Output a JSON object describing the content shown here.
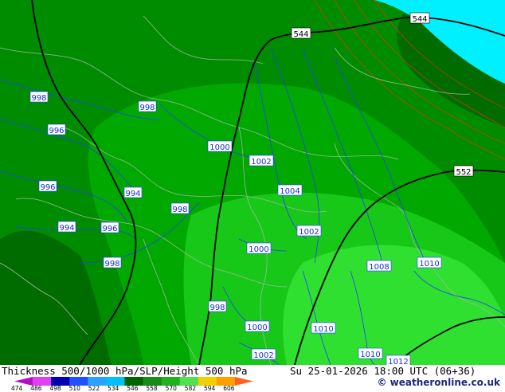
{
  "header": {
    "title": "Thickness 500/1000 hPa/SLP/Height 500 hPa",
    "valid_time": "Su 25-01-2026 18:00 UTC (06+36)",
    "credit": "© weatheronline.co.uk"
  },
  "legend": {
    "colors": [
      "#b010c0",
      "#e040f0",
      "#0000b0",
      "#2050ff",
      "#2aa0ff",
      "#00c0ff",
      "#006400",
      "#1a8a1a",
      "#20b020",
      "#50e050",
      "#f0d000",
      "#ffa000",
      "#ff6020"
    ],
    "ticks": [
      "474",
      "486",
      "498",
      "510",
      "522",
      "534",
      "546",
      "558",
      "570",
      "582",
      "594",
      "606"
    ]
  },
  "map": {
    "colors": {
      "sea": "#00f0ff",
      "dark_green": "#006c00",
      "mid_green": "#008c00",
      "green": "#00a800",
      "light_green": "#18c818",
      "bright_green": "#30e030",
      "isobar": "#2040ff",
      "height_contour": "#000000",
      "thickness_line": "#ff3000",
      "border": "#9ab89a"
    },
    "height_labels": [
      "544",
      "544",
      "552"
    ],
    "pressure_labels": [
      "998",
      "998",
      "996",
      "996",
      "994",
      "994",
      "996",
      "998",
      "998",
      "998",
      "1000",
      "1002",
      "1004",
      "1002",
      "1000",
      "1008",
      "1010",
      "1000",
      "1010",
      "1002",
      "1010",
      "1012"
    ]
  }
}
